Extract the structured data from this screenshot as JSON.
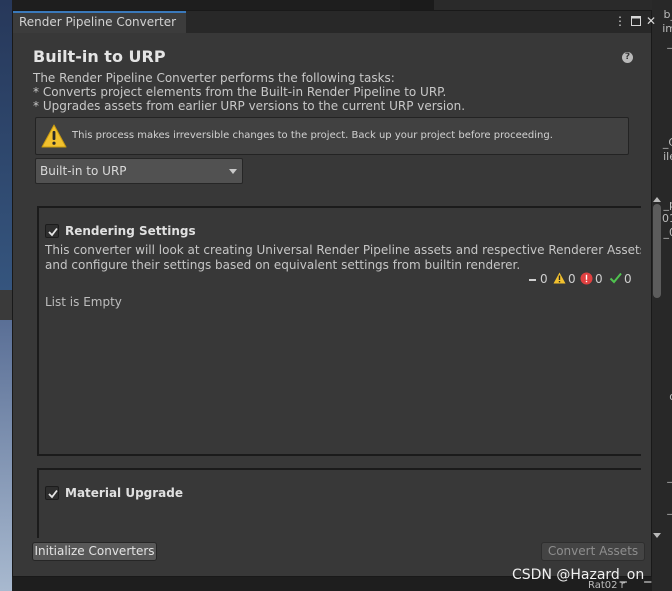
{
  "window": {
    "tab_title": "Render Pipeline Converter",
    "menu_icon": "kebab-menu-icon",
    "maximize_icon": "maximize-icon",
    "close_icon": "close-icon"
  },
  "header": {
    "title": "Built-in to URP",
    "help_icon": "help-icon",
    "description": [
      "The Render Pipeline Converter performs the following tasks:",
      "* Converts project elements from the Built-in Render Pipeline to URP.",
      "* Upgrades assets from earlier URP versions to the current URP version."
    ]
  },
  "warning": {
    "icon": "warning-icon",
    "text": "This process makes irreversible changes to the project. Back up your project before proceeding."
  },
  "converter_select": {
    "selected": "Built-in to URP"
  },
  "converters": [
    {
      "title": "Rendering Settings",
      "checked": true,
      "description": [
        "This converter will look at creating Universal Render Pipeline assets and respective Renderer Assets",
        "and configure their settings based on equivalent settings from builtin renderer."
      ],
      "status": {
        "pending": "0",
        "warnings": "0",
        "errors": "0",
        "success": "0"
      },
      "list_text": "List is Empty"
    },
    {
      "title": "Material Upgrade",
      "checked": true
    }
  ],
  "footer": {
    "initialize_label": "Initialize Converters",
    "convert_label": "Convert Assets"
  },
  "colors": {
    "accent": "#3a79bb",
    "warning": "#f2c12e",
    "error": "#e04040",
    "success": "#4fc34f"
  },
  "background_editor": {
    "right_fragments": [
      "b_",
      "im",
      "_I",
      "_C",
      "ile",
      "r",
      "_p",
      "01",
      "_0",
      "r",
      "o",
      "_I",
      "_I"
    ],
    "bottom_right_label": "Rat02 r"
  },
  "watermark": "CSDN @Hazard_on_"
}
